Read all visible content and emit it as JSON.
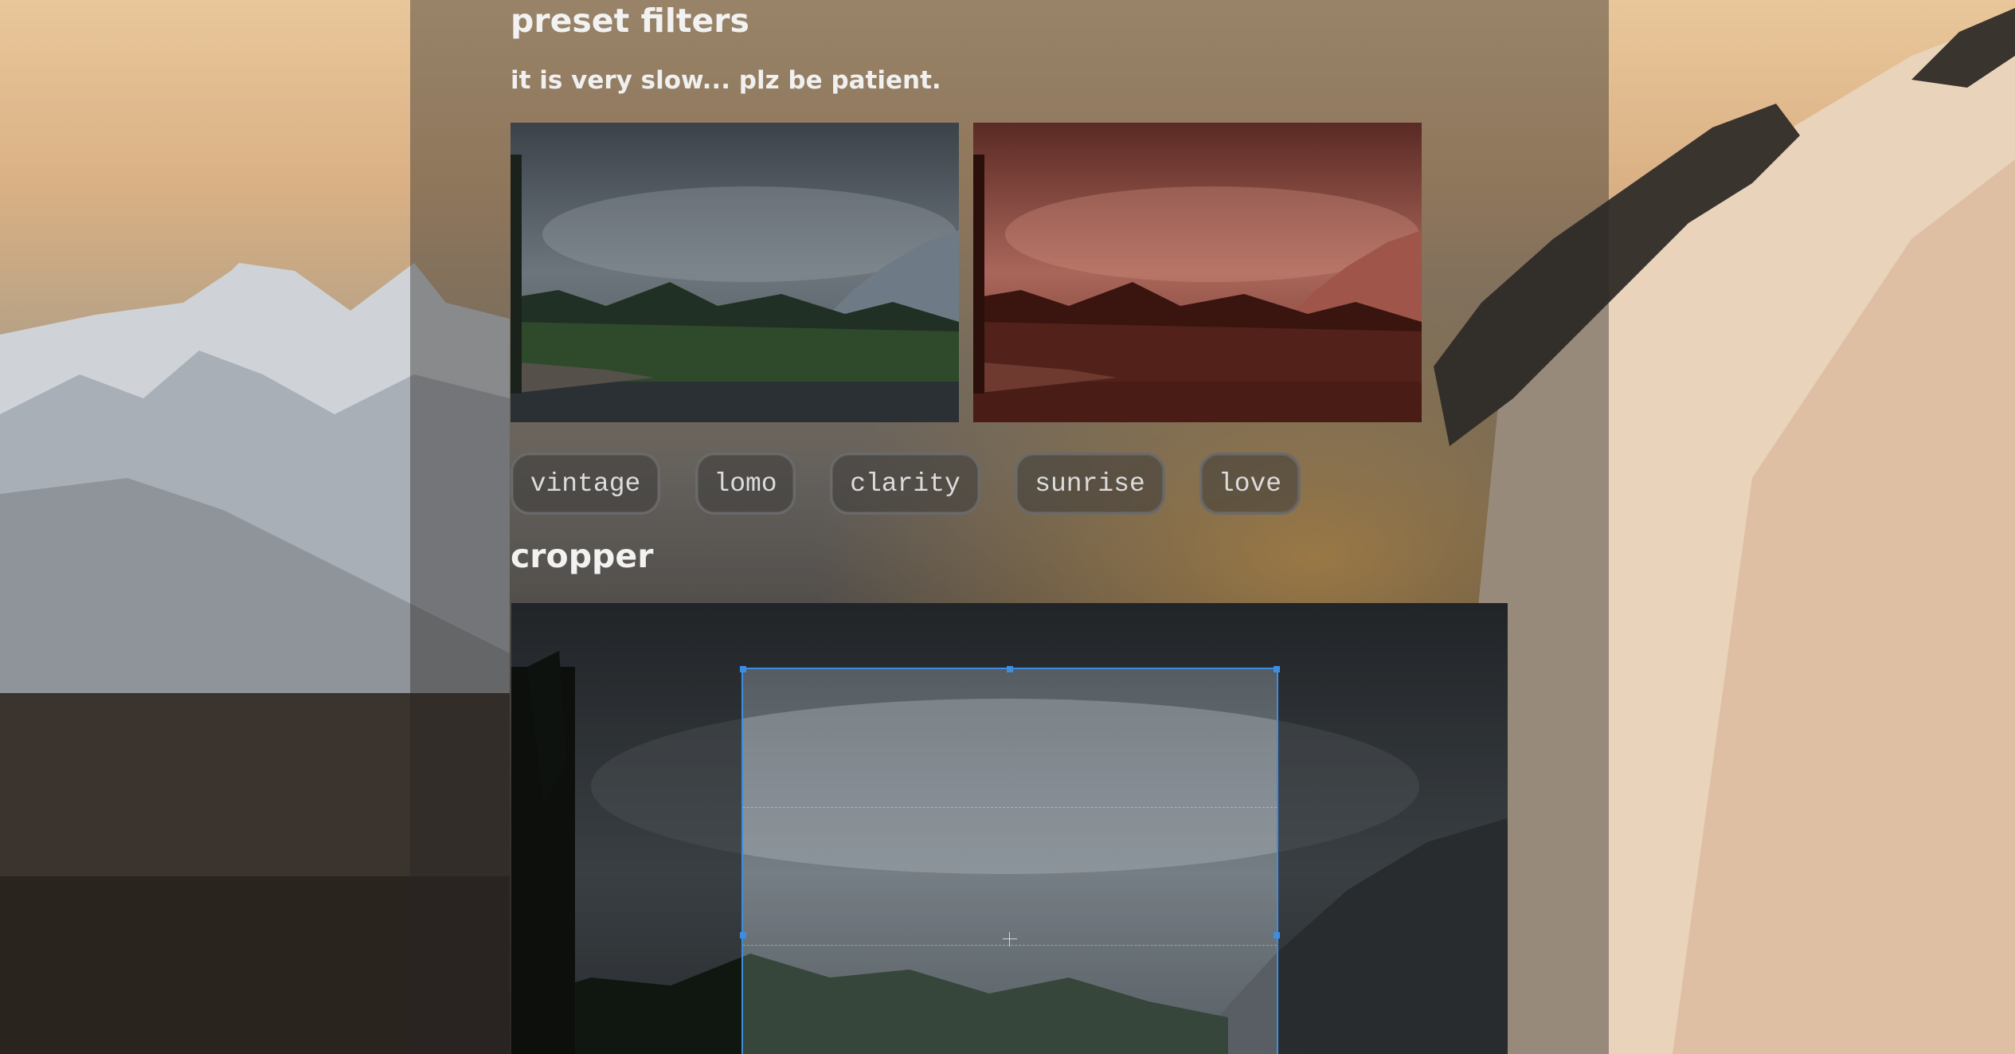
{
  "preset_filters": {
    "title": "preset filters",
    "subtitle": "it is very slow... plz be patient.",
    "buttons": [
      {
        "label": "vintage"
      },
      {
        "label": "lomo"
      },
      {
        "label": "clarity"
      },
      {
        "label": "sunrise"
      },
      {
        "label": "love"
      }
    ]
  },
  "cropper": {
    "title": "cropper"
  },
  "colors": {
    "crop_accent": "#3d8ee0",
    "filtered_tint": "#b4281e"
  }
}
